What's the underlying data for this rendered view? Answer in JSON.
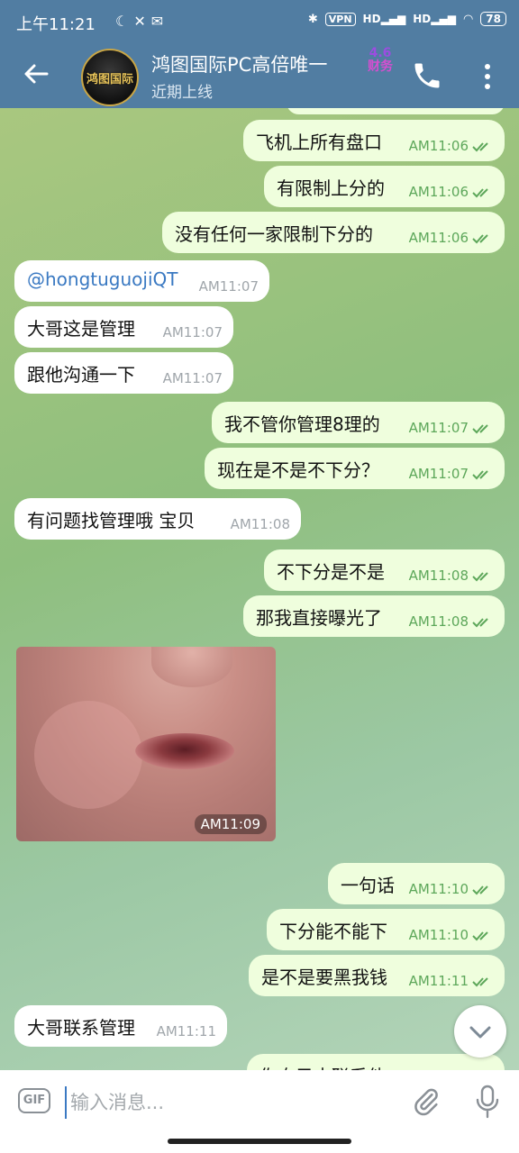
{
  "status_bar": {
    "time": "上午11:21",
    "vpn": "VPN",
    "network_1": "HD",
    "network_2": "HD",
    "battery": "78"
  },
  "header": {
    "title": "鸿图国际PC高倍唯一",
    "badge_line1": "4.6",
    "badge_line2": "财务",
    "subtitle": "近期上线",
    "avatar_text": "鸿图国际"
  },
  "messages": [
    {
      "dir": "out",
      "text": "飞机上所有盘口",
      "time": "AM11:06"
    },
    {
      "dir": "out",
      "text": "有限制上分的",
      "time": "AM11:06"
    },
    {
      "dir": "out",
      "text": "没有任何一家限制下分的",
      "time": "AM11:06"
    },
    {
      "dir": "in",
      "text": "@hongtuguojiQT",
      "time": "AM11:07"
    },
    {
      "dir": "in",
      "text": "大哥这是管理",
      "time": "AM11:07"
    },
    {
      "dir": "in",
      "text": "跟他沟通一下",
      "time": "AM11:07"
    },
    {
      "dir": "out",
      "text": "我不管你管理8理的",
      "time": "AM11:07"
    },
    {
      "dir": "out",
      "text": "现在是不是不下分？",
      "time": "AM11:07"
    },
    {
      "dir": "in",
      "text": "有问题找管理哦 宝贝",
      "time": "AM11:08"
    },
    {
      "dir": "out",
      "text": "不下分是不是",
      "time": "AM11:08"
    },
    {
      "dir": "out",
      "text": "那我直接曝光了",
      "time": "AM11:08"
    },
    {
      "dir": "out",
      "text": "一句话",
      "time": "AM11:10"
    },
    {
      "dir": "out",
      "text": "下分能不能下",
      "time": "AM11:10"
    },
    {
      "dir": "out",
      "text": "是不是要黑我钱",
      "time": "AM11:11"
    },
    {
      "dir": "in",
      "text": "大哥联系管理",
      "time": "AM11:11"
    },
    {
      "dir": "out",
      "text": "你自己去联系他",
      "time": ""
    }
  ],
  "photo": {
    "time": "AM11:09"
  },
  "input": {
    "placeholder": "输入消息...",
    "gif_label": "GIF"
  },
  "colors": {
    "header": "#517da2",
    "outgoing_bubble": "#effedd",
    "incoming_bubble": "#ffffff",
    "read_check": "#5da75a",
    "mention": "#3a79c2"
  }
}
